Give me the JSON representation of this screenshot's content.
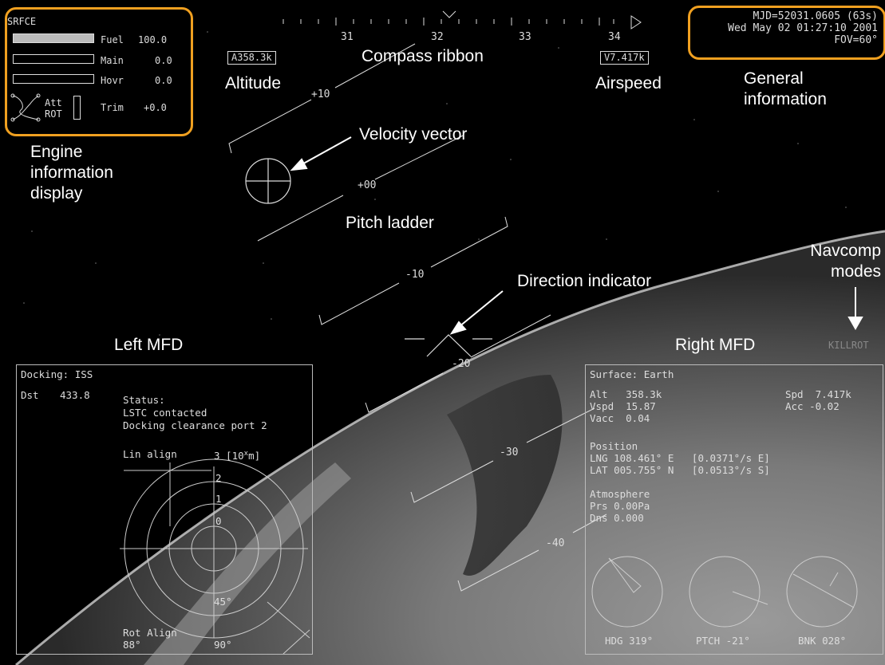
{
  "hud": {
    "mode": "SRFCE",
    "fuel_label": "Fuel",
    "fuel_value": "100.0",
    "main_label": "Main",
    "main_value": "0.0",
    "hovr_label": "Hovr",
    "hovr_value": "0.0",
    "att_label": "Att",
    "rot_label": "ROT",
    "trim_label": "Trim",
    "trim_value": "+0.0",
    "altitude_readout": "A358.3k",
    "airspeed_readout": "V7.417k",
    "compass_ticks": [
      "31",
      "32",
      "33",
      "34"
    ],
    "pitch_labels": [
      "+10",
      "+00",
      "-10",
      "-20",
      "-30",
      "-40"
    ],
    "mjd": "MJD=52031.0605 (63s)",
    "date": "Wed May 02 01:27:10 2001",
    "fov": "FOV=60°",
    "navcomp_mode": "KILLROT"
  },
  "captions": {
    "engine": "Engine information display",
    "altitude": "Altitude",
    "compass": "Compass ribbon",
    "airspeed": "Airspeed",
    "general": "General information",
    "velocity": "Velocity vector",
    "pitch": "Pitch ladder",
    "direction": "Direction indicator",
    "navcomp": "Navcomp modes",
    "left_mfd": "Left MFD",
    "right_mfd": "Right MFD"
  },
  "left_mfd": {
    "title": "Docking: ISS",
    "dst_label": "Dst",
    "dst_value": "433.8",
    "status_lines": [
      "Status:",
      "LSTC contacted",
      "Docking clearance port 2"
    ],
    "lin_align": "Lin align",
    "lin_scale": "3 [10",
    "lin_scale_sup": "x",
    "lin_unit": "m]",
    "scale_marks": [
      "2",
      "1",
      "0"
    ],
    "angle_45": "45°",
    "angle_90": "90°",
    "rot_align": "Rot Align",
    "rot_value": "88°"
  },
  "right_mfd": {
    "title": "Surface: Earth",
    "alt": "Alt   358.3k",
    "vspd": "Vspd  15.87",
    "vacc": "Vacc  0.04",
    "spd": "Spd  7.417k",
    "acc": "Acc -0.02",
    "position_label": "Position",
    "lng": "LNG 108.461° E   [0.0371°/s E]",
    "lat": "LAT 005.755° N   [0.0513°/s S]",
    "atmosphere_label": "Atmosphere",
    "prs": "Prs 0.00Pa",
    "dns": "Dns 0.000",
    "hdg": "HDG 319°",
    "ptch": "PTCH -21°",
    "bnk": "BNK 028°"
  },
  "colors": {
    "highlight": "#f0a020",
    "hud": "#dddddd",
    "background": "#000000"
  }
}
